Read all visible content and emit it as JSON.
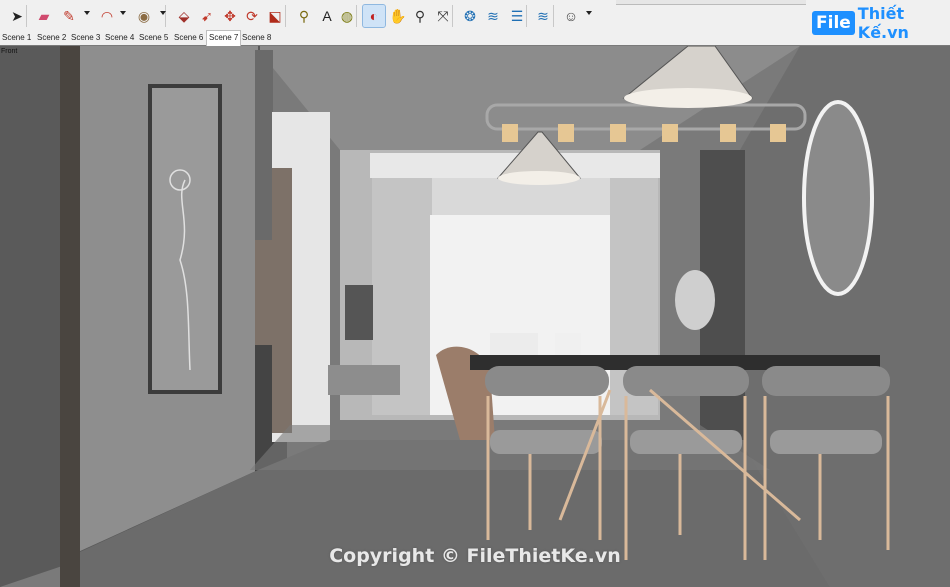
{
  "toolbar": {
    "tools": [
      {
        "name": "select-tool",
        "icon": "arrow-icon",
        "glyph": "➤"
      },
      {
        "name": "eraser-tool",
        "icon": "eraser-icon",
        "glyph": "▰"
      },
      {
        "name": "line-tool",
        "icon": "pencil-icon",
        "glyph": "✎"
      },
      {
        "name": "arc-tool",
        "icon": "arc-icon",
        "glyph": "◠"
      },
      {
        "name": "shapes-tool",
        "icon": "circle-icon",
        "glyph": "◉"
      },
      {
        "name": "push-pull-tool",
        "icon": "push-pull-icon",
        "glyph": "⬙"
      },
      {
        "name": "follow-me-tool",
        "icon": "follow-me-icon",
        "glyph": "➹"
      },
      {
        "name": "move-tool",
        "icon": "move-icon",
        "glyph": "✥"
      },
      {
        "name": "rotate-tool",
        "icon": "rotate-icon",
        "glyph": "⟳"
      },
      {
        "name": "scale-tool",
        "icon": "scale-icon",
        "glyph": "⬕"
      },
      {
        "name": "tape-measure-tool",
        "icon": "tape-icon",
        "glyph": "⚲"
      },
      {
        "name": "text-tool",
        "icon": "text-icon",
        "glyph": "A"
      },
      {
        "name": "paint-bucket-tool",
        "icon": "paint-bucket-icon",
        "glyph": "◍"
      },
      {
        "name": "orbit-tool",
        "icon": "orbit-icon",
        "glyph": "◐"
      },
      {
        "name": "pan-tool",
        "icon": "hand-icon",
        "glyph": "✋"
      },
      {
        "name": "zoom-tool",
        "icon": "magnifier-icon",
        "glyph": "⚲"
      },
      {
        "name": "zoom-extents-tool",
        "icon": "zoom-extents-icon",
        "glyph": "⤧"
      },
      {
        "name": "warehouse-tool",
        "icon": "warehouse-icon",
        "glyph": "❂"
      },
      {
        "name": "extension-tool",
        "icon": "extension-icon",
        "glyph": "≋"
      },
      {
        "name": "layers-tool",
        "icon": "layers-icon",
        "glyph": "☰"
      },
      {
        "name": "sandbox-tool",
        "icon": "sandbox-icon",
        "glyph": "≋"
      },
      {
        "name": "account-tool",
        "icon": "user-icon",
        "glyph": "☺"
      }
    ]
  },
  "scenes": [
    "Scene 1",
    "Scene 2",
    "Scene 3",
    "Scene 4",
    "Scene 5",
    "Scene 6",
    "Scene 7",
    "Scene 8"
  ],
  "active_scene": "Scene 7",
  "view_label": "Front",
  "brand": {
    "box": "File",
    "text": "Thiết Kế.vn"
  },
  "watermark": "Copyright © FileThietKe.vn",
  "colors": {
    "toolbar_bg": "#f0f0f0",
    "brand": "#1e90ff",
    "active_tool": "#cfe3f7"
  }
}
